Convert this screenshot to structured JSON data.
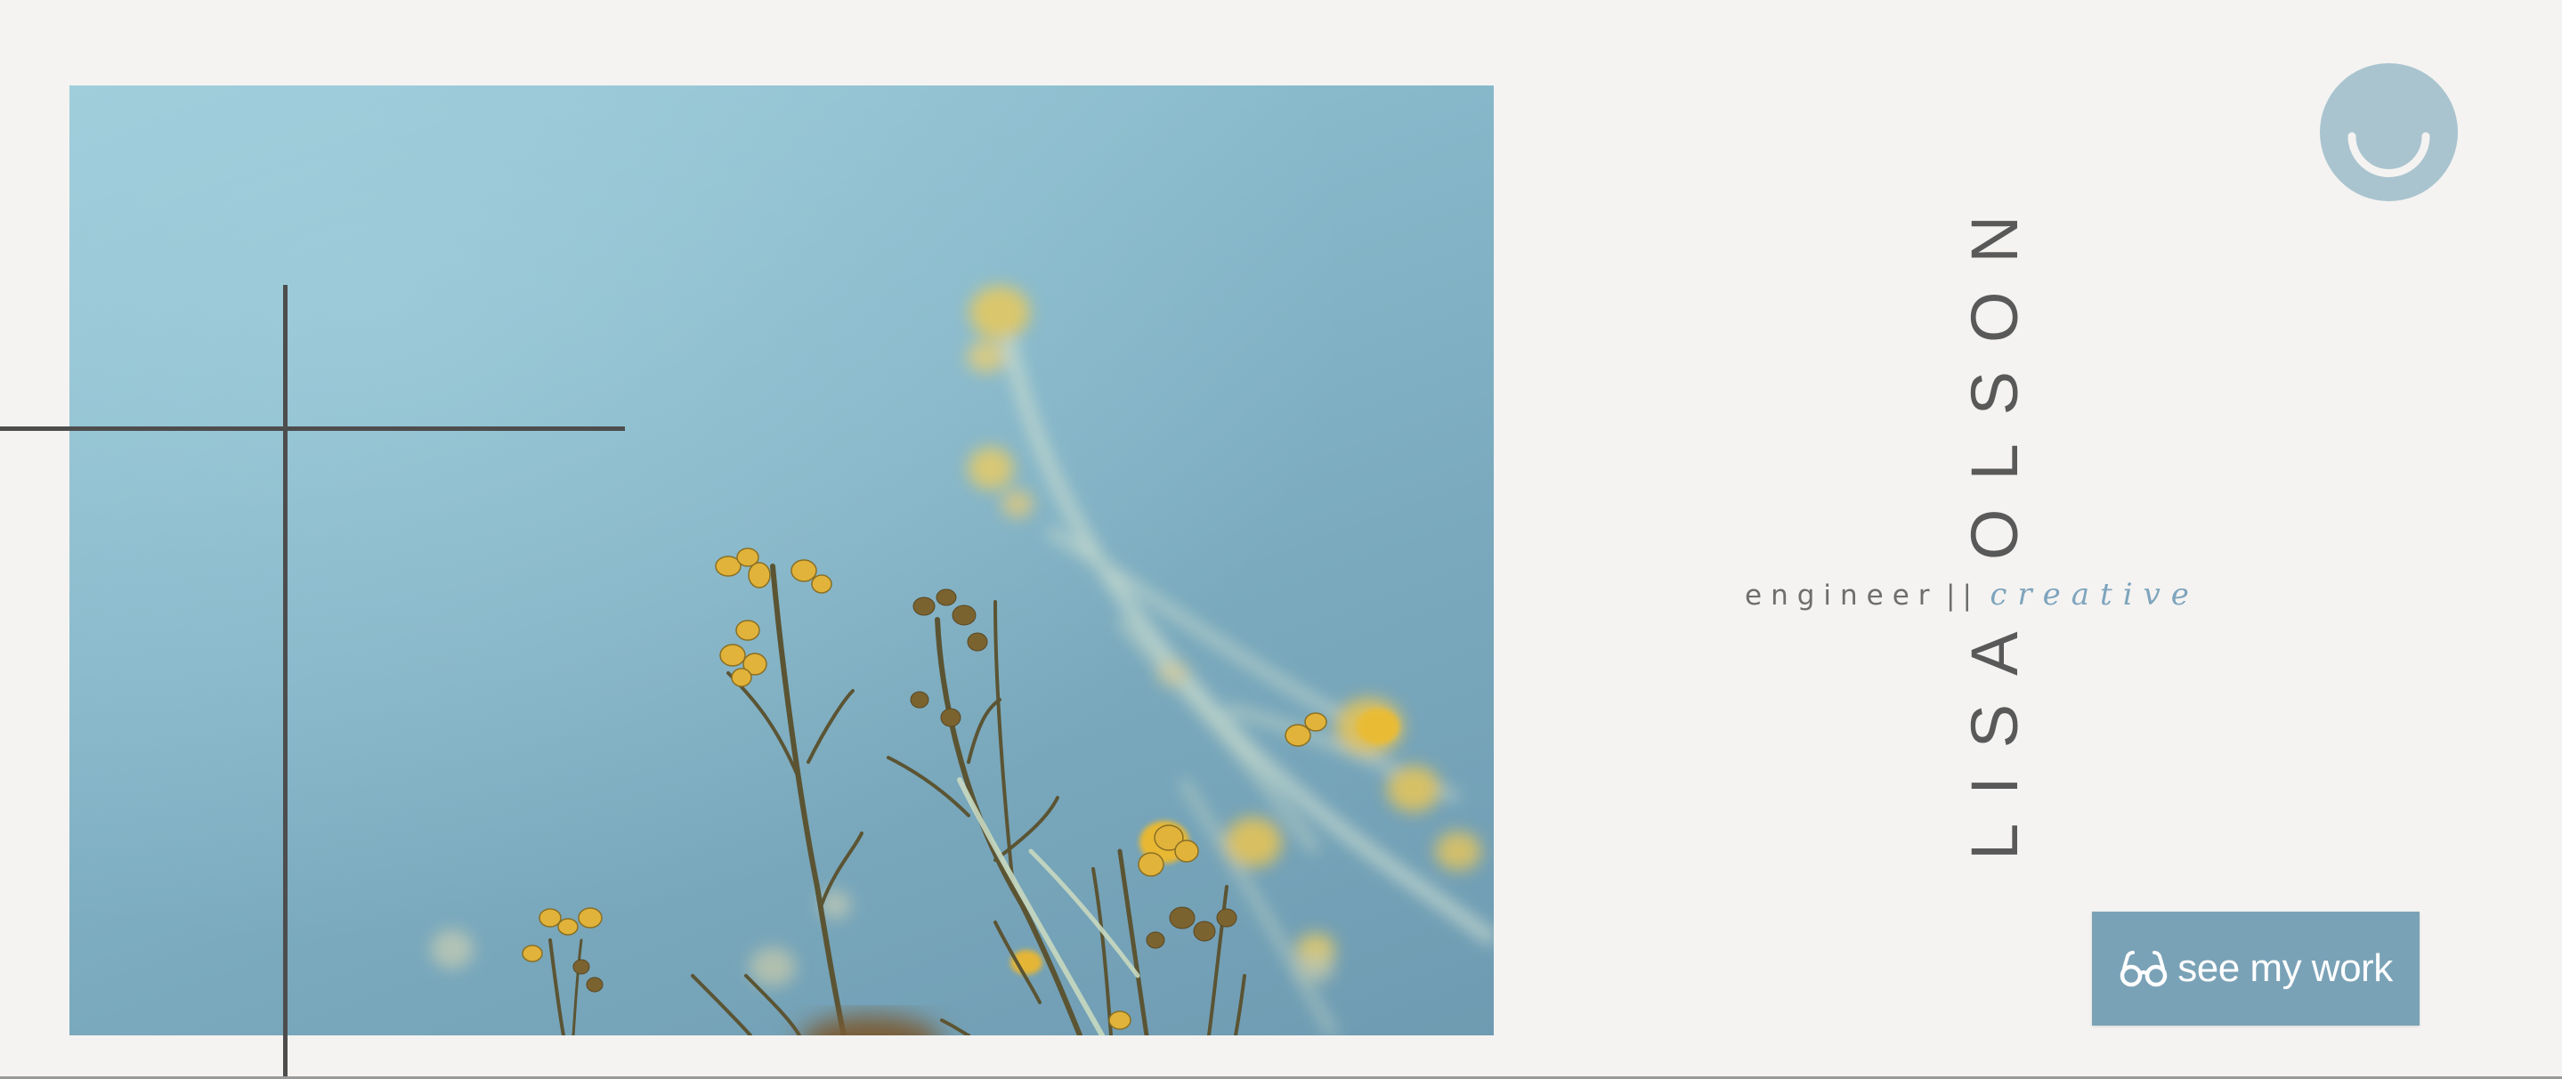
{
  "hero": {
    "image": "photo of yellow wildflower stems against a pale blue sky"
  },
  "logo": {
    "icon": "smiley-icon",
    "color": "#a9c4cf"
  },
  "profile": {
    "name": "LISA OLSON",
    "role": "engineer",
    "separator": "||",
    "creative": "creative"
  },
  "cta": {
    "icon": "glasses-icon",
    "label": "see my work",
    "color": "#7aa2b7"
  },
  "colors": {
    "background": "#f4f3f1",
    "text": "#595959",
    "accent": "#7ea4bd"
  }
}
